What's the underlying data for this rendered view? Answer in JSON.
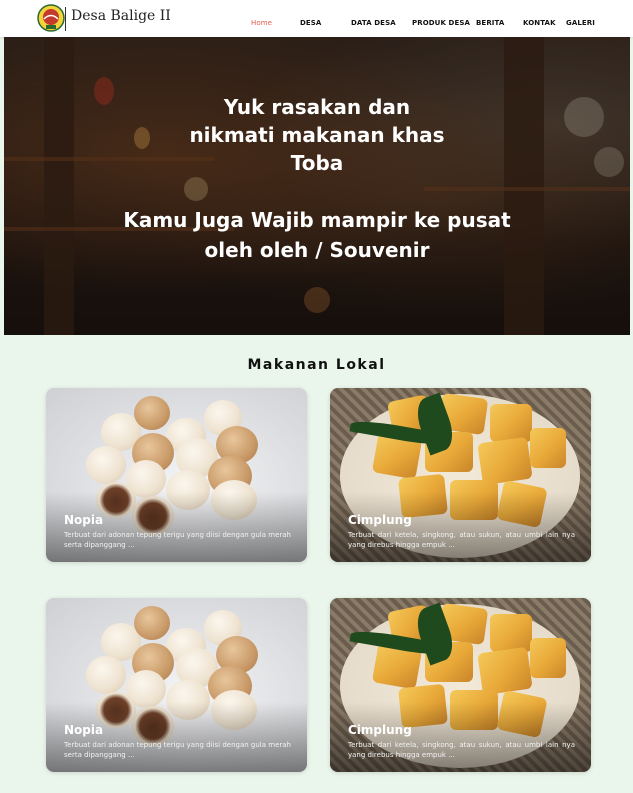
{
  "nav": {
    "brand": "Desa Balige II",
    "links": [
      "Home",
      "DESA",
      "DATA DESA",
      "PRODUK DESA",
      "BERITA",
      "KONTAK",
      "GALERI"
    ],
    "active_color": "#e45b4e"
  },
  "hero": {
    "title_lines": [
      "Yuk rasakan dan",
      "nikmati makanan khas",
      "Toba"
    ],
    "subtitle_lines": [
      "Kamu Juga Wajib mampir ke pusat",
      "oleh oleh / Souvenir"
    ]
  },
  "section": {
    "title": "Makanan Lokal"
  },
  "cards": [
    {
      "title": "Nopia",
      "desc": "Terbuat dari adonan tepung terigu yang diisi dengan gula merah serta dipanggang ...",
      "image": "nopia"
    },
    {
      "title": "Cimplung",
      "desc": "Terbuat dari ketela, singkong, atau sukun, atau umbi lain nya yang direbus hingga empuk ...",
      "image": "cimplung"
    },
    {
      "title": "Nopia",
      "desc": "Terbuat dari adonan tepung terigu yang diisi dengan gula merah serta dipanggang ...",
      "image": "nopia"
    },
    {
      "title": "Cimplung",
      "desc": "Terbuat dari ketela, singkong, atau sukun, atau umbi lain nya yang direbus hingga empuk ...",
      "image": "cimplung"
    }
  ],
  "colors": {
    "page_background": "#eaf6ec",
    "accent": "#e45b4e"
  }
}
